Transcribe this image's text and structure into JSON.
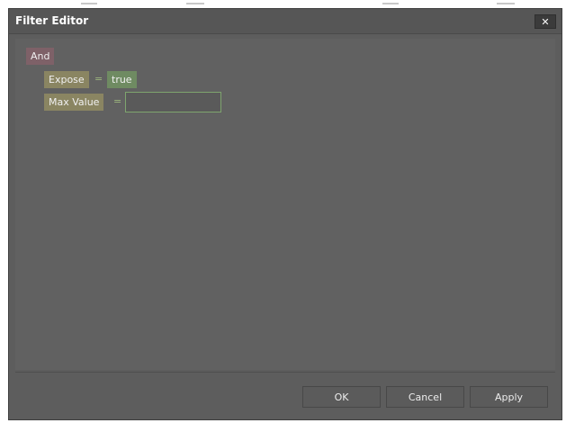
{
  "dialog": {
    "title": "Filter Editor",
    "close_icon": "close-icon",
    "close_glyph": "✕"
  },
  "filter": {
    "group_label": "And",
    "conditions": [
      {
        "field": "Expose",
        "operator": "=",
        "value": "true"
      },
      {
        "field": "Max Value",
        "operator": "=",
        "value": ""
      }
    ]
  },
  "footer": {
    "ok_label": "OK",
    "cancel_label": "Cancel",
    "apply_label": "Apply"
  }
}
